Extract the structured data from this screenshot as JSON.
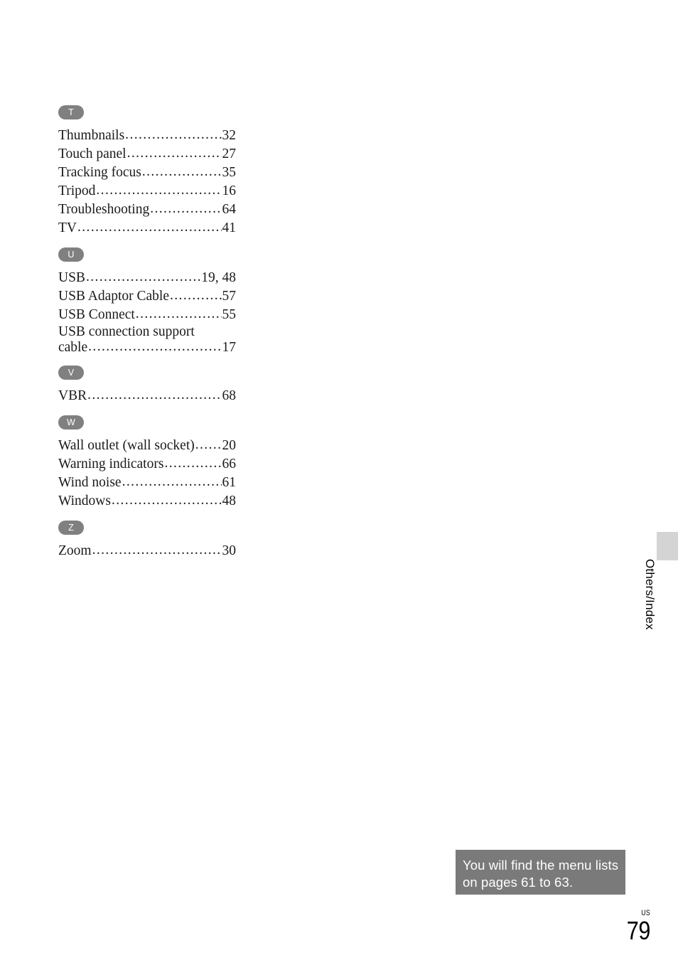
{
  "page": {
    "region_code": "US",
    "number": "79",
    "side_tab_label": "Others/Index"
  },
  "callout": {
    "text": "You will find the menu lists on pages 61 to 63."
  },
  "index": {
    "groups": [
      {
        "letter": "T",
        "entries": [
          {
            "label": "Thumbnails",
            "page": "32"
          },
          {
            "label": "Touch panel",
            "page": "27"
          },
          {
            "label": "Tracking focus",
            "page": "35"
          },
          {
            "label": "Tripod",
            "page": "16"
          },
          {
            "label": "Troubleshooting",
            "page": "64"
          },
          {
            "label": "TV",
            "page": "41"
          }
        ]
      },
      {
        "letter": "U",
        "entries": [
          {
            "label": "USB",
            "page": "19, 48"
          },
          {
            "label": "USB Adaptor Cable",
            "page": "57"
          },
          {
            "label": "USB Connect",
            "page": "55"
          },
          {
            "label": "USB connection support",
            "label2": "cable",
            "page": "17",
            "wrapped": true
          }
        ]
      },
      {
        "letter": "V",
        "entries": [
          {
            "label": "VBR",
            "page": "68"
          }
        ]
      },
      {
        "letter": "W",
        "entries": [
          {
            "label": "Wall outlet (wall socket)",
            "page": "20"
          },
          {
            "label": "Warning indicators",
            "page": "66"
          },
          {
            "label": "Wind noise",
            "page": "61"
          },
          {
            "label": "Windows",
            "page": "48"
          }
        ]
      },
      {
        "letter": "Z",
        "entries": [
          {
            "label": "Zoom",
            "page": "30"
          }
        ]
      }
    ]
  }
}
